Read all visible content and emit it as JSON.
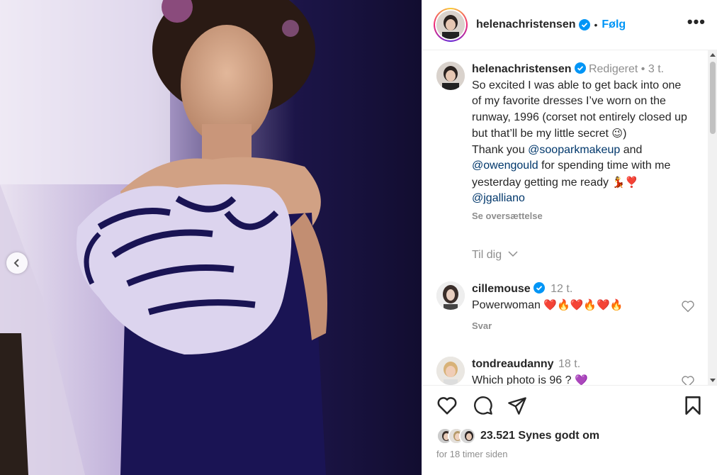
{
  "post": {
    "username": "helenachristensen",
    "follow_label": "Følg",
    "dot": "•",
    "more": "•••"
  },
  "caption": {
    "username": "helenachristensen",
    "edited": "Redigeret",
    "dot": "•",
    "time": "3 t.",
    "line1": "So excited I was able to get back into one of my favorite dresses I’ve worn on the runway, 1996 (corset not entirely closed up but that’ll be my little secret",
    "line1_emoji": "😉",
    "close_paren": ")",
    "thanks_prefix": "Thank you ",
    "mention1": "@sooparkmakeup",
    "and": " and ",
    "mention2": "@owengould",
    "thanks_suffix": " for spending time with me yesterday getting me ready",
    "thanks_emoji": "💃❣️",
    "mention3": "@jgalliano",
    "see_translation": "Se oversættelse"
  },
  "til_dig": "Til dig",
  "comments": [
    {
      "username": "cillemouse",
      "time": "12 t.",
      "text": "Powerwoman",
      "emoji": "❤️🔥❤️🔥❤️🔥",
      "reply": "Svar"
    },
    {
      "username": "tondreaudanny",
      "time": "18 t.",
      "text": "Which photo is 96 ?",
      "emoji": "💜"
    }
  ],
  "likes": {
    "count": "23.521",
    "label": "Synes godt om"
  },
  "posted": "for 18 timer siden",
  "colors": {
    "accent": "#0095f6",
    "text": "#262626",
    "muted": "#8e8e8e",
    "link": "#00376b",
    "heart": "#ed4956"
  }
}
